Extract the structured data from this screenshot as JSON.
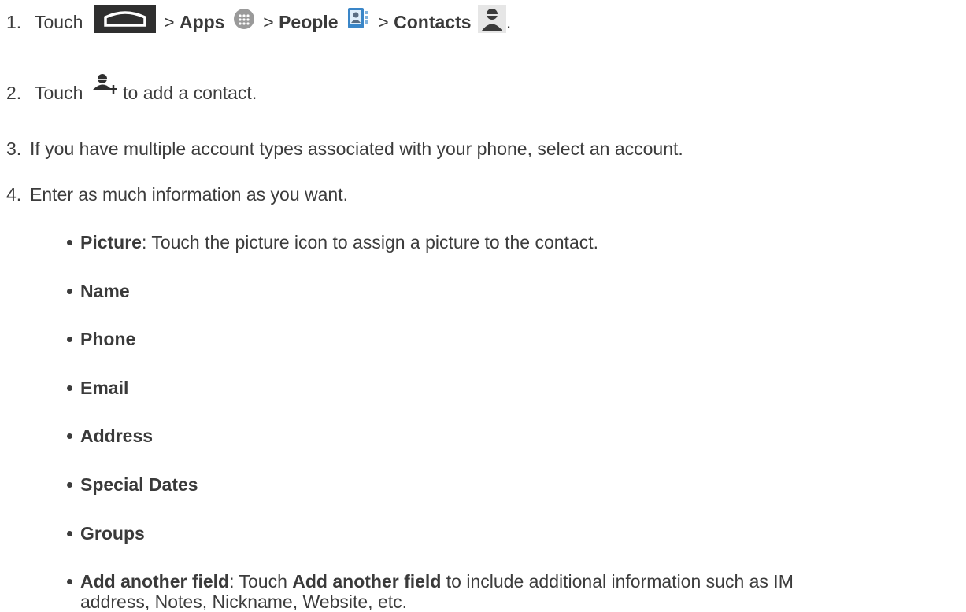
{
  "steps": [
    {
      "number": "1.",
      "text_touch": "Touch",
      "sep": ">",
      "apps": "Apps",
      "people": "People",
      "contacts": "Contacts",
      "end": ".",
      "icons": [
        "home-button-icon",
        "apps-grid-icon",
        "people-app-icon",
        "contacts-person-icon"
      ]
    },
    {
      "number": "2.",
      "text_touch": "Touch",
      "text_rest": "to add a contact.",
      "icon": "add-contact-icon"
    },
    {
      "number": "3.",
      "text": "If you have multiple account types associated with your phone, select an account."
    },
    {
      "number": "4.",
      "text": "Enter as much information as you want."
    }
  ],
  "fields": [
    {
      "label": "Picture",
      "desc": ": Touch the picture icon to assign a picture to the contact."
    },
    {
      "label": "Name"
    },
    {
      "label": "Phone"
    },
    {
      "label": "Email"
    },
    {
      "label": "Address"
    },
    {
      "label": "Special Dates"
    },
    {
      "label": "Groups"
    },
    {
      "label": "Add another field",
      "desc_a": ": Touch ",
      "label2": "Add another field",
      "desc_b": " to include additional information such as IM",
      "desc_line2": "address, Notes, Nickname, Website, etc."
    }
  ],
  "colors": {
    "text": "#3c3c3c",
    "icon_dark": "#2f2f2f",
    "icon_gray": "#8a8a8a",
    "people_blue": "#3a86c8"
  }
}
